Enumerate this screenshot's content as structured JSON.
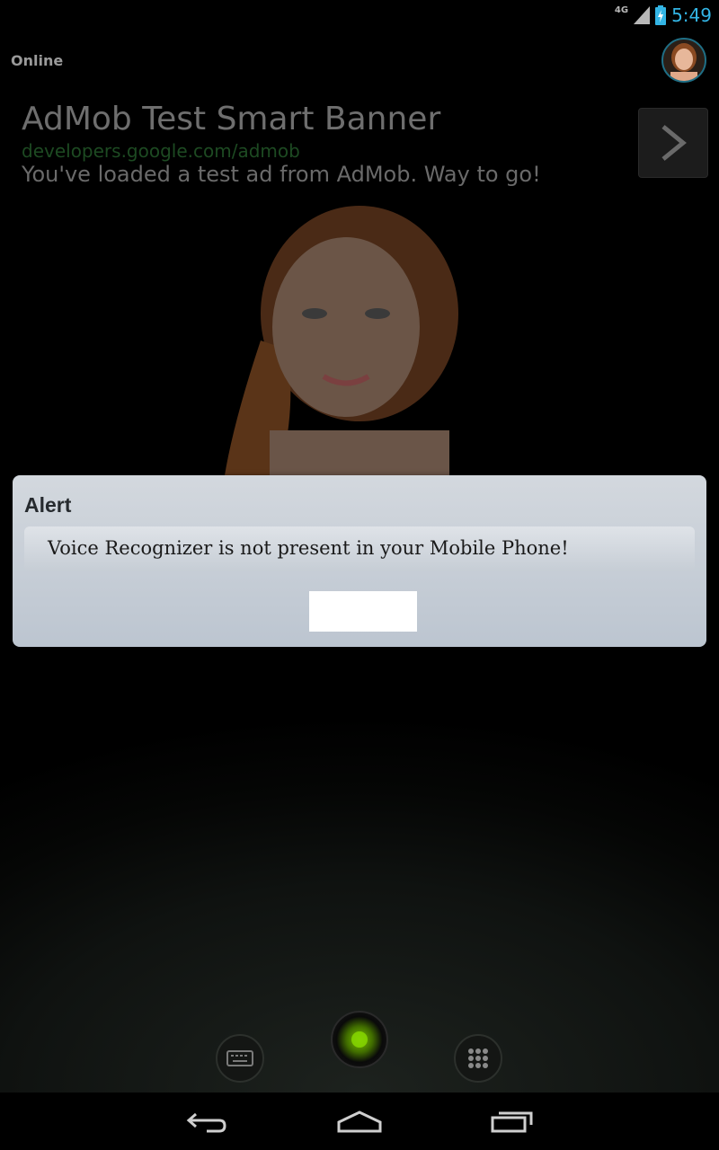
{
  "status_bar": {
    "network_type": "4G",
    "time": "5:49",
    "icons": [
      "signal-icon",
      "battery-charging-icon"
    ]
  },
  "header": {
    "status_label": "Online"
  },
  "ad": {
    "title": "AdMob Test Smart Banner",
    "url": "developers.google.com/admob",
    "description": "You've loaded a test ad from AdMob. Way to go!"
  },
  "dialog": {
    "title": "Alert",
    "message": "Voice Recognizer is not present in your Mobile Phone!",
    "button_label": ""
  },
  "controls": [
    "keyboard-icon",
    "mic-icon",
    "app-grid-icon"
  ],
  "nav": [
    "back-icon",
    "home-icon",
    "recent-apps-icon"
  ]
}
